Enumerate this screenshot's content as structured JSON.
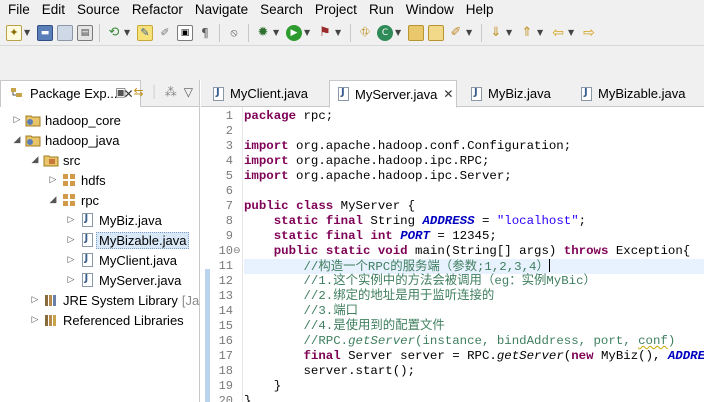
{
  "menu": [
    "File",
    "Edit",
    "Source",
    "Refactor",
    "Navigate",
    "Search",
    "Project",
    "Run",
    "Window",
    "Help"
  ],
  "package_explorer": {
    "title": "Package Exp...",
    "tree": [
      {
        "label": "hadoop_core"
      },
      {
        "label": "hadoop_java"
      },
      {
        "label": "src"
      },
      {
        "label": "hdfs"
      },
      {
        "label": "rpc"
      },
      {
        "label": "MyBiz.java"
      },
      {
        "label": "MyBizable.java"
      },
      {
        "label": "MyClient.java"
      },
      {
        "label": "MyServer.java"
      },
      {
        "label": "JRE System Library",
        "suffix": "[Ja"
      },
      {
        "label": "Referenced Libraries"
      }
    ]
  },
  "editor": {
    "tabs": [
      {
        "label": "MyClient.java"
      },
      {
        "label": "MyServer.java",
        "active": true
      },
      {
        "label": "MyBiz.java"
      },
      {
        "label": "MyBizable.java"
      }
    ],
    "line_numbers": [
      "1",
      "2",
      "3",
      "4",
      "5",
      "6",
      "7",
      "8",
      "9",
      "10",
      "11",
      "12",
      "13",
      "14",
      "15",
      "16",
      "17",
      "18",
      "19",
      "20"
    ],
    "code": [
      "package rpc;",
      "",
      "import org.apache.hadoop.conf.Configuration;",
      "import org.apache.hadoop.ipc.RPC;",
      "import org.apache.hadoop.ipc.Server;",
      "",
      "public class MyServer {",
      "    static final String ADDRESS = \"localhost\";",
      "    static final int PORT = 12345;",
      "    public static void main(String[] args) throws Exception{",
      "        //构造一个RPC的服务端（参数;1,2,3,4）",
      "        //1.这个实例中的方法会被调用（eg：实例MyBic）",
      "        //2.绑定的地址是用于监听连接的",
      "        //3.端口",
      "        //4.是使用到的配置文件",
      "        //RPC.getServer(instance, bindAddress, port, conf)",
      "        final Server server = RPC.getServer(new MyBiz(), ADDRESS,",
      "        server.start();",
      "    }",
      "}"
    ]
  },
  "colors": {
    "keyword": "#7f0055",
    "string": "#2a00ff",
    "constant": "#0000c0",
    "comment": "#3f7f5f",
    "current_line": "#e8f2fe"
  }
}
